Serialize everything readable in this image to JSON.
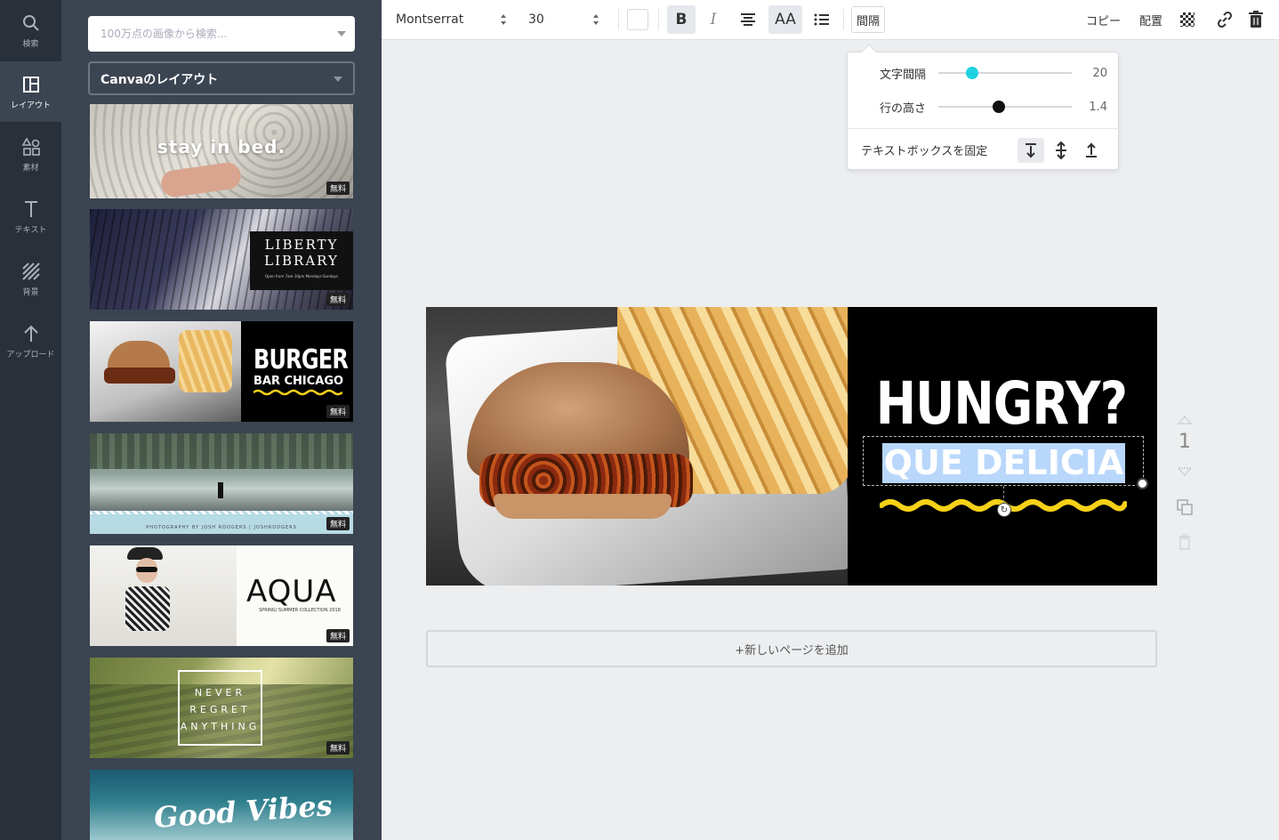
{
  "rail": {
    "items": [
      {
        "label": "検索",
        "icon": "search-icon"
      },
      {
        "label": "レイアウト",
        "icon": "layout-icon"
      },
      {
        "label": "素材",
        "icon": "elements-icon"
      },
      {
        "label": "テキスト",
        "icon": "text-icon"
      },
      {
        "label": "背景",
        "icon": "background-icon"
      },
      {
        "label": "アップロード",
        "icon": "upload-icon"
      }
    ],
    "active": "レイアウト"
  },
  "panel": {
    "search_placeholder": "100万点の画像から検索...",
    "category": "Canvaのレイアウト",
    "free_badge": "無料",
    "layouts": [
      {
        "text": "stay in bed."
      },
      {
        "text_line1": "LIBERTY",
        "text_line2": "LIBRARY",
        "text_small": "Open from 7am-10pm Mondays-Sundays"
      },
      {
        "text_line1": "BURGER",
        "text_line2": "BAR CHICAGO"
      },
      {
        "text_small": "PHOTOGRAPHY BY JOSH RODGERS  |  JOSHRODGERS"
      },
      {
        "text_line1": "AQUA",
        "text_small": "SPRING/ SUMMER COLLECTION 2018"
      },
      {
        "text_line1": "NEVER",
        "text_line2": "REGRET",
        "text_line3": "ANYTHING"
      },
      {
        "text": "Good Vibes"
      }
    ]
  },
  "toolbar": {
    "font": "Montserrat",
    "size": "30",
    "bold": "B",
    "italic": "I",
    "uppercase": "AA",
    "spacing": "間隔",
    "copy": "コピー",
    "arrange": "配置",
    "color": "#ffffff"
  },
  "spacing_popover": {
    "letter_spacing_label": "文字間隔",
    "letter_spacing_value": "20",
    "letter_spacing_level": 0.25,
    "line_height_label": "行の高さ",
    "line_height_value": "1.4",
    "line_height_level": 0.45,
    "anchor_label": "テキストボックスを固定",
    "accent_color": "#1fd1e0"
  },
  "design": {
    "headline": "HUNGRY?",
    "subline": "QUE DELICIA",
    "squiggle_color": "#f7d117",
    "selection_color": "#b8d7fb"
  },
  "page_controls": {
    "page_number": "1"
  },
  "add_page": "+新しいページを追加"
}
